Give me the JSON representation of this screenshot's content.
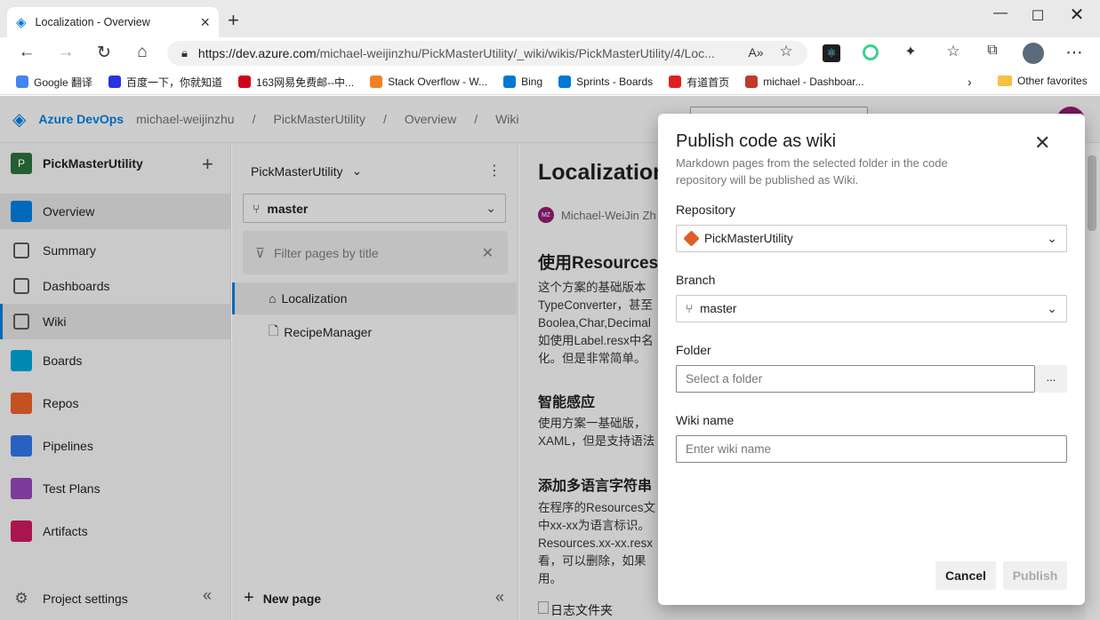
{
  "browser": {
    "tab_title": "Localization - Overview",
    "url_host": "https://dev.azure.com",
    "url_path": "/michael-weijinzhu/PickMasterUtility/_wiki/wikis/PickMasterUtility/4/Loc...",
    "favorites": [
      {
        "label": "Google 翻译",
        "color": "#4285f4"
      },
      {
        "label": "百度一下，你就知道",
        "color": "#2932e1"
      },
      {
        "label": "163网易免费邮--中...",
        "color": "#d0021b"
      },
      {
        "label": "Stack Overflow - W...",
        "color": "#f48024"
      },
      {
        "label": "Bing",
        "color": "#0078d4"
      },
      {
        "label": "Sprints - Boards",
        "color": "#0078d4"
      },
      {
        "label": "有道首页",
        "color": "#e02020"
      },
      {
        "label": "michael - Dashboar...",
        "color": "#c0392b"
      }
    ],
    "other_favorites": "Other favorites"
  },
  "header": {
    "brand": "Azure DevOps",
    "breadcrumb": [
      "michael-weijinzhu",
      "PickMasterUtility",
      "Overview",
      "Wiki"
    ]
  },
  "sidebar": {
    "project": "PickMasterUtility",
    "project_initial": "P",
    "items": [
      {
        "label": "Overview",
        "color": "#0078d4"
      },
      {
        "label": "Summary",
        "color": "#555"
      },
      {
        "label": "Dashboards",
        "color": "#555"
      },
      {
        "label": "Wiki",
        "color": "#555"
      },
      {
        "label": "Boards",
        "color": "#009ccc"
      },
      {
        "label": "Repos",
        "color": "#e05d26"
      },
      {
        "label": "Pipelines",
        "color": "#2f6fdb"
      },
      {
        "label": "Test Plans",
        "color": "#8e44ad"
      },
      {
        "label": "Artifacts",
        "color": "#c2185b"
      }
    ],
    "settings": "Project settings"
  },
  "wiki": {
    "selector": "PickMasterUtility",
    "branch": "master",
    "filter_placeholder": "Filter pages by title",
    "pages": [
      "Localization",
      "RecipeManager"
    ],
    "new_page": "New page"
  },
  "content": {
    "title": "Localization",
    "author": "Michael-WeiJin Zh",
    "author_initials": "MZ",
    "h1": "使用Resources文",
    "p1": [
      "这个方案的基础版本",
      "TypeConverter，甚至",
      "Boolea,Char,Decimal",
      "如使用Label.resx中名",
      "化。但是非常简单。"
    ],
    "h2": "智能感应",
    "p2": [
      "使用方案一基础版，",
      "XAML，但是支持语法"
    ],
    "h3": "添加多语言字符串",
    "p3": [
      "在程序的Resources文",
      "中xx-xx为语言标识。",
      "Resources.xx-xx.resx",
      "看，可以删除，如果",
      "用。"
    ],
    "img_alt": "日志文件夹"
  },
  "dialog": {
    "title": "Publish code as wiki",
    "subtitle": "Markdown pages from the selected folder in the code repository will be published as Wiki.",
    "repository_label": "Repository",
    "repository_value": "PickMasterUtility",
    "branch_label": "Branch",
    "branch_value": "master",
    "folder_label": "Folder",
    "folder_placeholder": "Select a folder",
    "browse": "...",
    "wikiname_label": "Wiki name",
    "wikiname_placeholder": "Enter wiki name",
    "cancel": "Cancel",
    "publish": "Publish"
  }
}
